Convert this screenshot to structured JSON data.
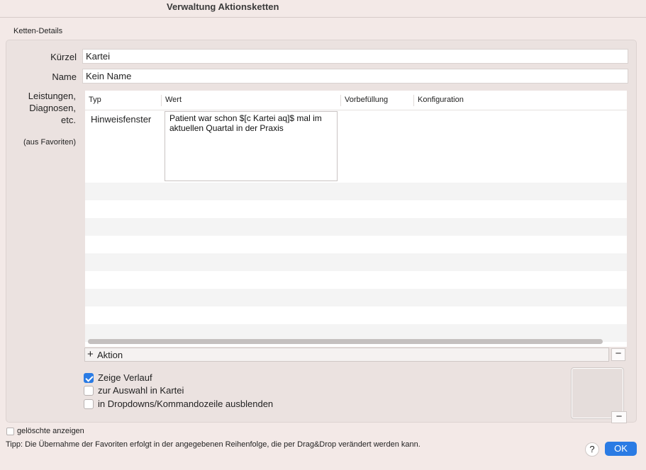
{
  "window": {
    "title": "Verwaltung Aktionsketten"
  },
  "group": {
    "label": "Ketten-Details"
  },
  "fields": {
    "kuerzel_label": "Kürzel",
    "kuerzel_value": "Kartei",
    "name_label": "Name",
    "name_value": "Kein Name"
  },
  "side": {
    "line1": "Leistungen,",
    "line2": "Diagnosen,",
    "line3": "etc.",
    "favorites": "(aus Favoriten)"
  },
  "table": {
    "columns": [
      "Typ",
      "Wert",
      "Vorbefüllung",
      "Konfiguration"
    ],
    "rows": [
      {
        "typ": "Hinweisfenster",
        "wert": "Patient war schon $[c Kartei aq]$ mal im aktuellen Quartal in der Praxis",
        "vorbefuellung": "",
        "konfiguration": ""
      }
    ]
  },
  "actions": {
    "add_label": "Aktion",
    "add_symbol": "+",
    "remove_symbol": "−"
  },
  "options": [
    {
      "label": "Zeige Verlauf",
      "checked": true
    },
    {
      "label": "zur Auswahl in Kartei",
      "checked": false
    },
    {
      "label": "in Dropdowns/Kommandozeile ausblenden",
      "checked": false
    }
  ],
  "image_well": {
    "remove_symbol": "−"
  },
  "footer": {
    "show_deleted_label": "gelöschte anzeigen",
    "show_deleted_checked": false,
    "tip": "Tipp: Die Übernahme der Favoriten erfolgt in der angegebenen Reihenfolge, die per Drag&Drop verändert werden kann.",
    "help_symbol": "?",
    "ok_label": "OK"
  },
  "colors": {
    "accent": "#2a7be4",
    "window_bg": "#f3e9e7",
    "group_bg": "#ebe2e0",
    "stripe": "#f4f4f4"
  }
}
